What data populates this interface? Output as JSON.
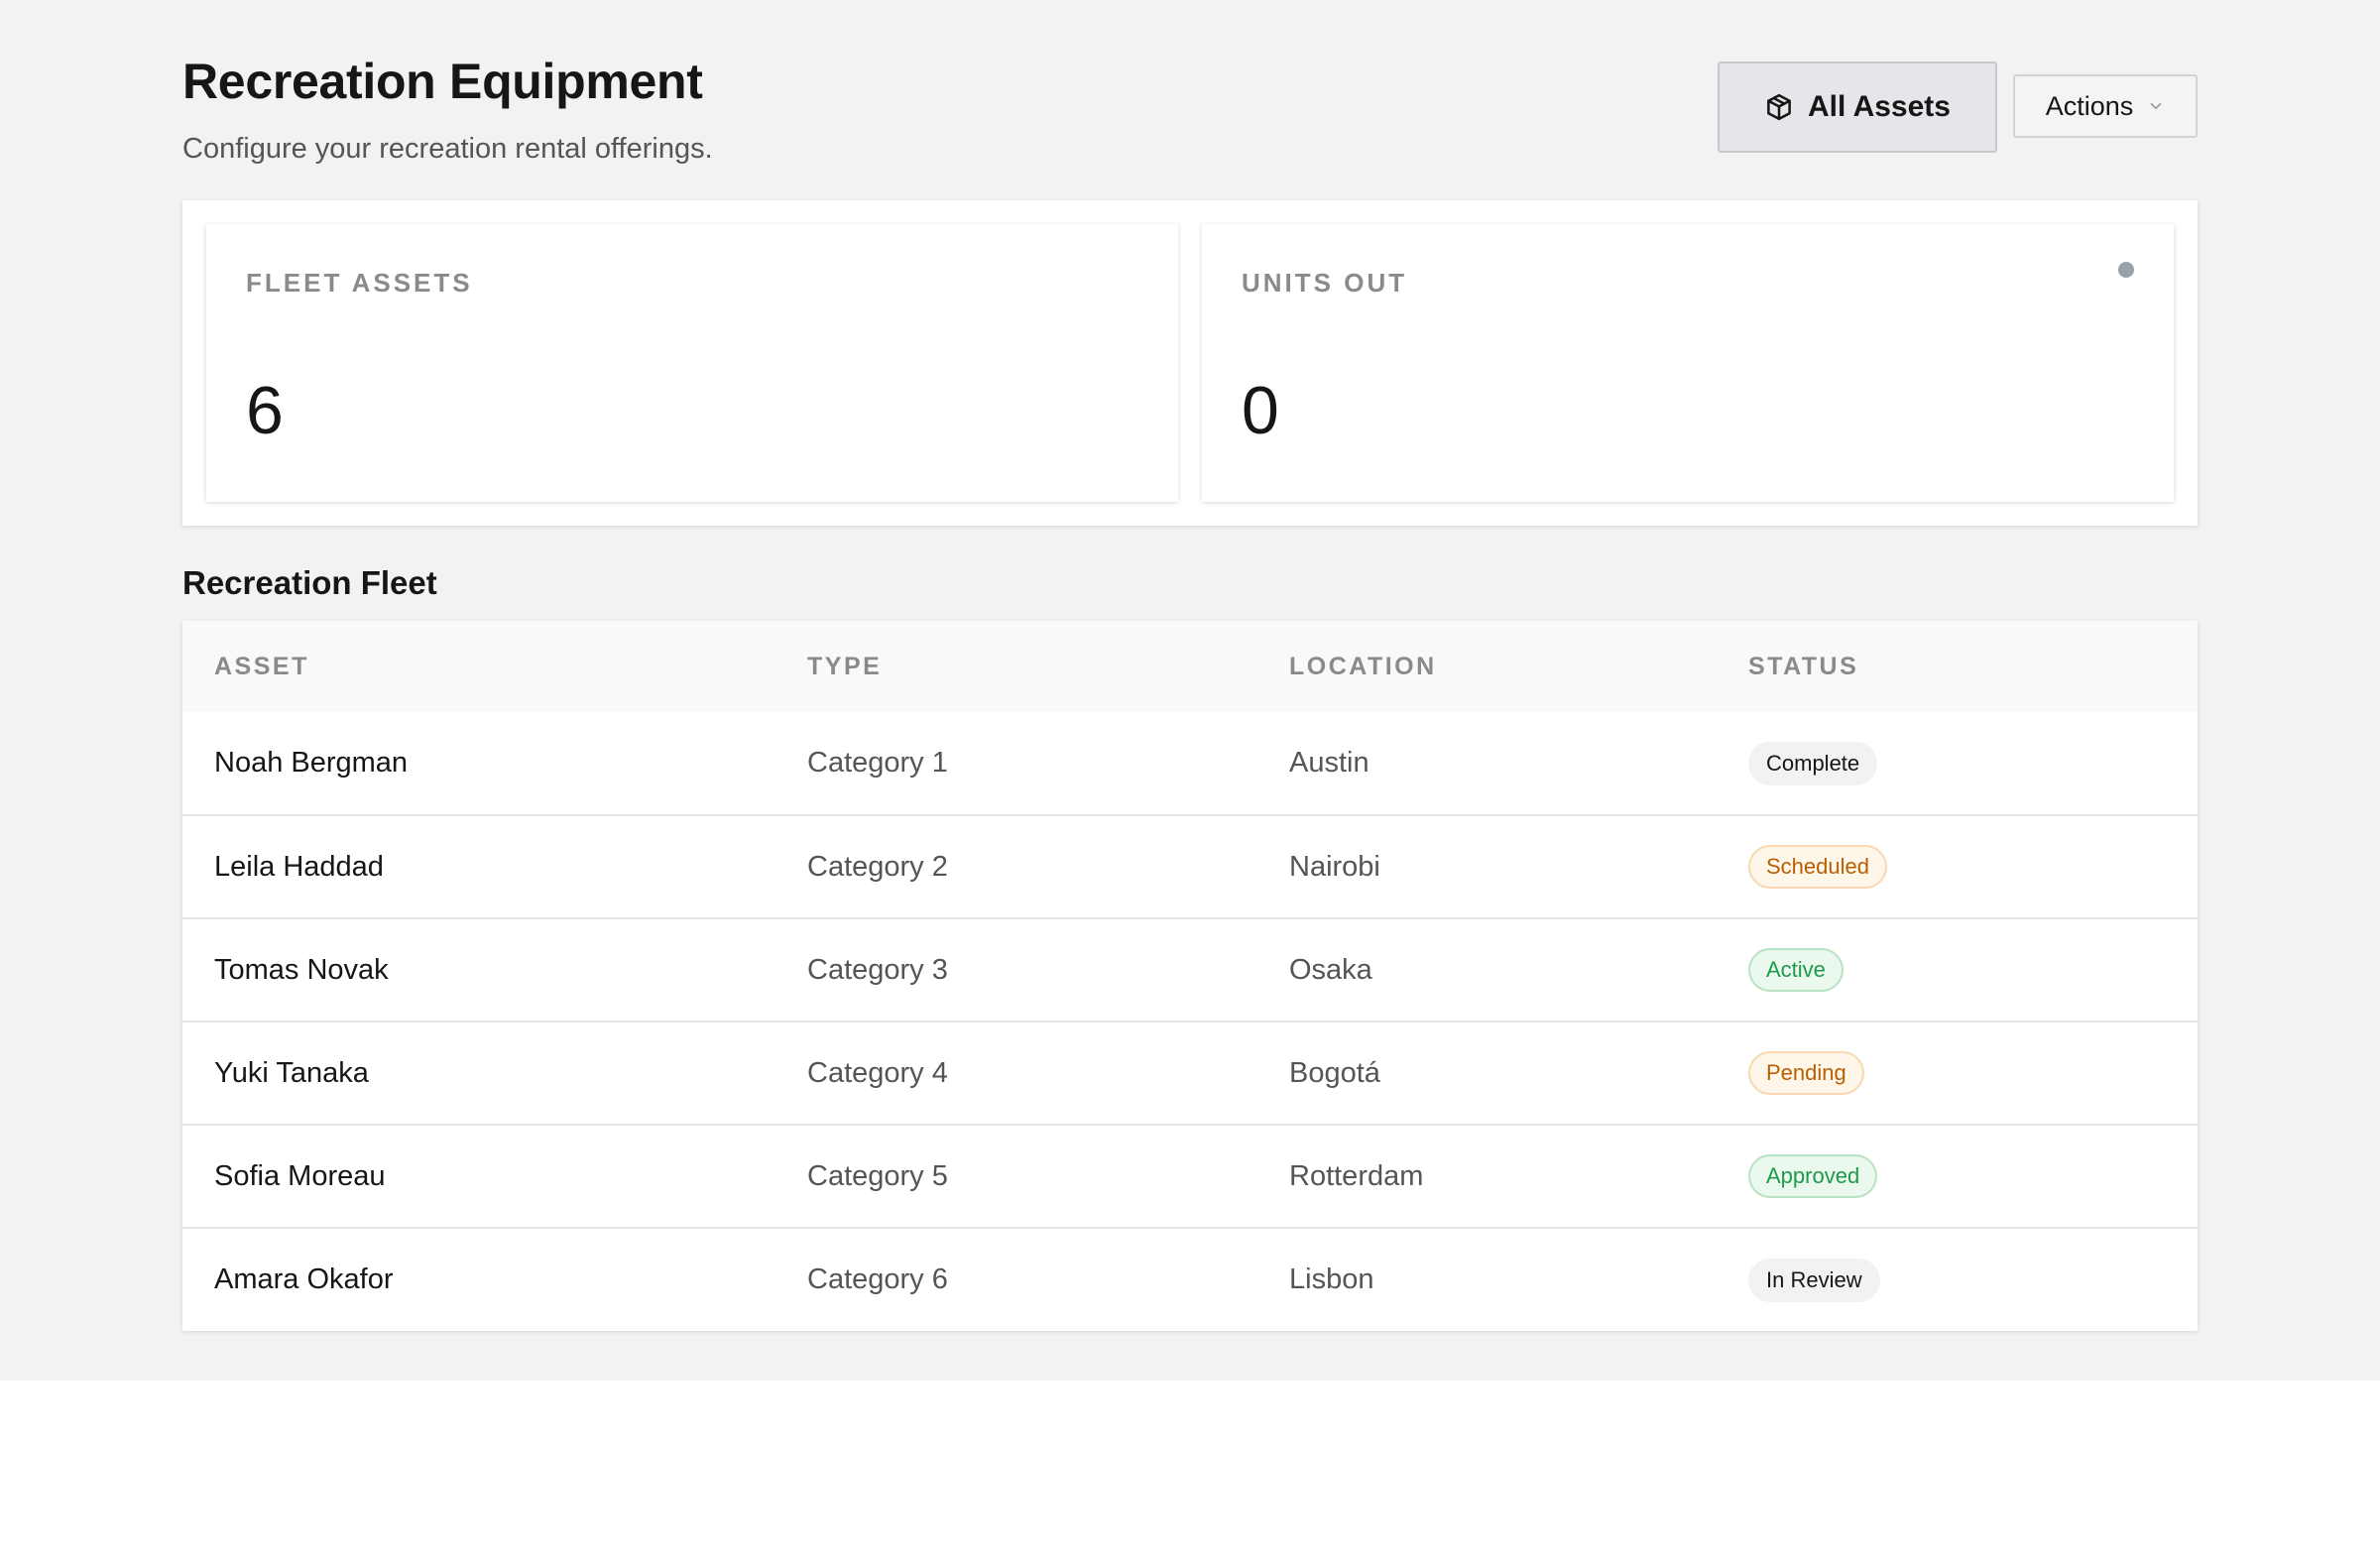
{
  "header": {
    "title": "Recreation Equipment",
    "subtitle": "Configure your recreation rental offerings.",
    "primary_button": {
      "label": "All Assets",
      "icon": "box-icon"
    },
    "secondary_button": {
      "label": "Actions",
      "icon": "chevron-down-icon"
    }
  },
  "stats": [
    {
      "label": "FLEET ASSETS",
      "value": "6"
    },
    {
      "label": "UNITS OUT",
      "value": "0",
      "indicator_color": "#9aa0a8"
    }
  ],
  "fleet": {
    "title": "Recreation Fleet",
    "columns": [
      "ASSET",
      "TYPE",
      "LOCATION",
      "STATUS"
    ],
    "rows": [
      {
        "asset": "Noah Bergman",
        "type": "Category 1",
        "location": "Austin",
        "status": "Complete",
        "status_tone": "neutral"
      },
      {
        "asset": "Leila Haddad",
        "type": "Category 2",
        "location": "Nairobi",
        "status": "Scheduled",
        "status_tone": "warn"
      },
      {
        "asset": "Tomas Novak",
        "type": "Category 3",
        "location": "Osaka",
        "status": "Active",
        "status_tone": "success"
      },
      {
        "asset": "Yuki Tanaka",
        "type": "Category 4",
        "location": "Bogotá",
        "status": "Pending",
        "status_tone": "warn"
      },
      {
        "asset": "Sofia Moreau",
        "type": "Category 5",
        "location": "Rotterdam",
        "status": "Approved",
        "status_tone": "success"
      },
      {
        "asset": "Amara Okafor",
        "type": "Category 6",
        "location": "Lisbon",
        "status": "In Review",
        "status_tone": "neutral"
      }
    ]
  },
  "colors": {
    "page_background": "#f2f2f2",
    "primary_button_bg": "#e4e6e9",
    "warn": "#b85f00",
    "success": "#1e9a4a"
  }
}
